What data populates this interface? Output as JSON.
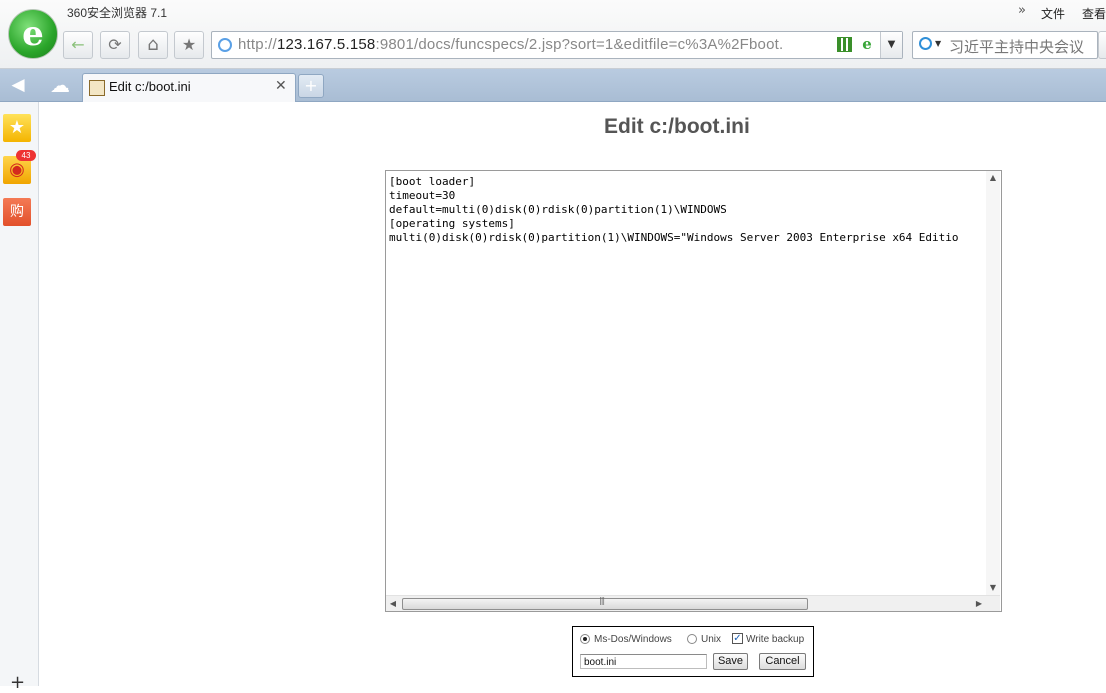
{
  "browser": {
    "app_title": "360安全浏览器 7.1",
    "menu": {
      "chevron": "»",
      "file": "文件",
      "view": "查看"
    },
    "toolbar": {
      "back_icon": "←",
      "refresh_icon": "⟳",
      "home_icon": "⌂",
      "favorite_icon": "★"
    },
    "address": {
      "scheme": "http://",
      "host": "123.167.5.158",
      "rest": ":9801/docs/funcspecs/2.jsp?sort=1&editfile=c%3A%2Fboot.",
      "dropdown_icon": "▼"
    },
    "search": {
      "text": "习近平主持中央会议",
      "tri": "▼"
    }
  },
  "tabs": {
    "sidebar_toggle_icon": "◀",
    "cloud_icon": "☁",
    "active": {
      "label": "Edit c:/boot.ini",
      "close": "✕"
    },
    "new_tab": "+"
  },
  "sidebar": {
    "favorites_icon": "★",
    "weibo_icon": "◉",
    "weibo_badge": "43",
    "shop_icon": "购",
    "add": "+"
  },
  "page": {
    "title": "Edit c:/boot.ini",
    "file_content": "[boot loader]\ntimeout=30\ndefault=multi(0)disk(0)rdisk(0)partition(1)\\WINDOWS\n[operating systems]\nmulti(0)disk(0)rdisk(0)partition(1)\\WINDOWS=\"Windows Server 2003 Enterprise x64 Editio",
    "scroll": {
      "up": "▲",
      "down": "▼",
      "left": "◀",
      "right": "▶",
      "grip": "|||"
    },
    "form": {
      "option_dos": "Ms-Dos/Windows",
      "option_unix": "Unix",
      "write_backup": "Write backup",
      "check_mark": "✓",
      "filename": "boot.ini",
      "save": "Save",
      "cancel": "Cancel"
    }
  }
}
